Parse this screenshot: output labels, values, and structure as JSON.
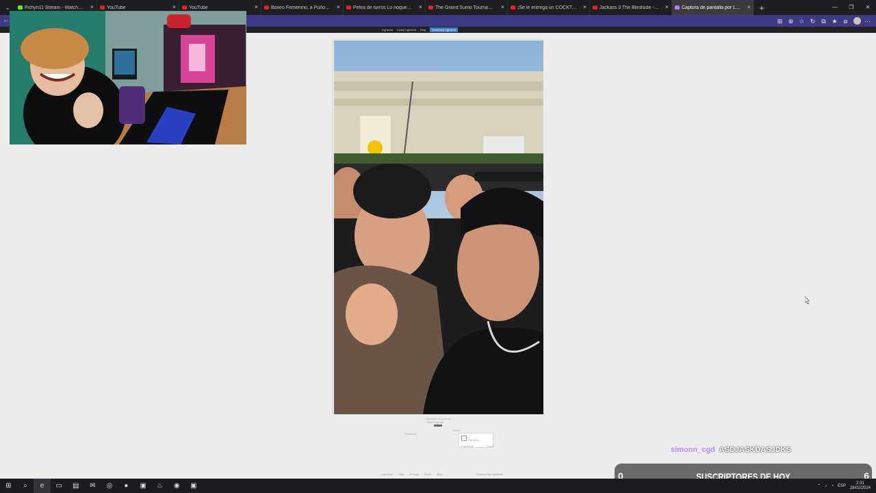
{
  "browser": {
    "tabs": [
      {
        "label": "Fichyn11 Stream - Watch Live on",
        "kind": "kick",
        "active": false
      },
      {
        "label": "YouTube",
        "kind": "yt",
        "active": false
      },
      {
        "label": "YouTube",
        "kind": "yt",
        "active": false
      },
      {
        "label": "Boxeo Femenino, a Puño Limpio",
        "kind": "yt",
        "active": false
      },
      {
        "label": "Pelea de turros Lo noquea de un",
        "kind": "yt",
        "active": false
      },
      {
        "label": "The Grand Sumo Tournament Du",
        "kind": "yt",
        "active": false
      },
      {
        "label": "¡Se le entrega un COCKTAIL DE SU",
        "kind": "yt",
        "active": false
      },
      {
        "label": "Jackass 3 The Blindside - YouTube",
        "kind": "yt",
        "active": false
      },
      {
        "label": "Captura de pantalla por Lightshot",
        "kind": "light",
        "active": true
      }
    ],
    "close_glyph": "×",
    "new_tab_glyph": "+",
    "window_controls": [
      "—",
      "❐",
      "✕"
    ]
  },
  "toolbar": {
    "back_glyph": "←",
    "icons": [
      "apps-icon",
      "zoom-icon",
      "star-icon",
      "refresh-icon",
      "extensions-icon",
      "favorites-icon",
      "collections-icon",
      "profile-icon",
      "more-icon"
    ],
    "glyphs": [
      "⊞",
      "⊕",
      "☆",
      "↻",
      "⧉",
      "★",
      "⧈",
      "",
      "⋯"
    ]
  },
  "page": {
    "nav": [
      "Lightshot",
      "Install Lightshot",
      "Blog"
    ],
    "nav_button": "Download Lightshot",
    "image_caption": "Lightshot screenshot",
    "report": "Report image",
    "share_label": "Share",
    "like_label": "Facebook",
    "social_count": "0",
    "social_extra": "Lightshot",
    "social_tweet": "Tweet",
    "footer_links": [
      "Lightshot",
      "Help",
      "Privacy",
      "Terms",
      "Blog"
    ],
    "footer_right": "Powered by Lightshot"
  },
  "overlay": {
    "chat_user": "simonn_cgd",
    "chat_message": "ASDJASKDASJDKS",
    "sub_min": "0",
    "sub_label": "SUSCRIPTORES DE HOY",
    "sub_max": "6"
  },
  "taskbar": {
    "app_names": [
      "windows-start",
      "search",
      "edge",
      "file-explorer",
      "microsoft-store",
      "mail",
      "discord",
      "spotify",
      "news",
      "steam",
      "obs",
      "app"
    ],
    "app_glyphs": [
      "⊞",
      "⌕",
      "e",
      "▭",
      "▤",
      "✉",
      "◎",
      "●",
      "▣",
      "♨",
      "◉",
      "▣"
    ],
    "language": "ESP",
    "time": "2:31",
    "date": "28/02/2024"
  },
  "colors": {
    "tab_strip": "#1e1f22",
    "toolbar": "#3e3a86",
    "page_bg": "#ececec",
    "chat_user": "#b58cff"
  }
}
